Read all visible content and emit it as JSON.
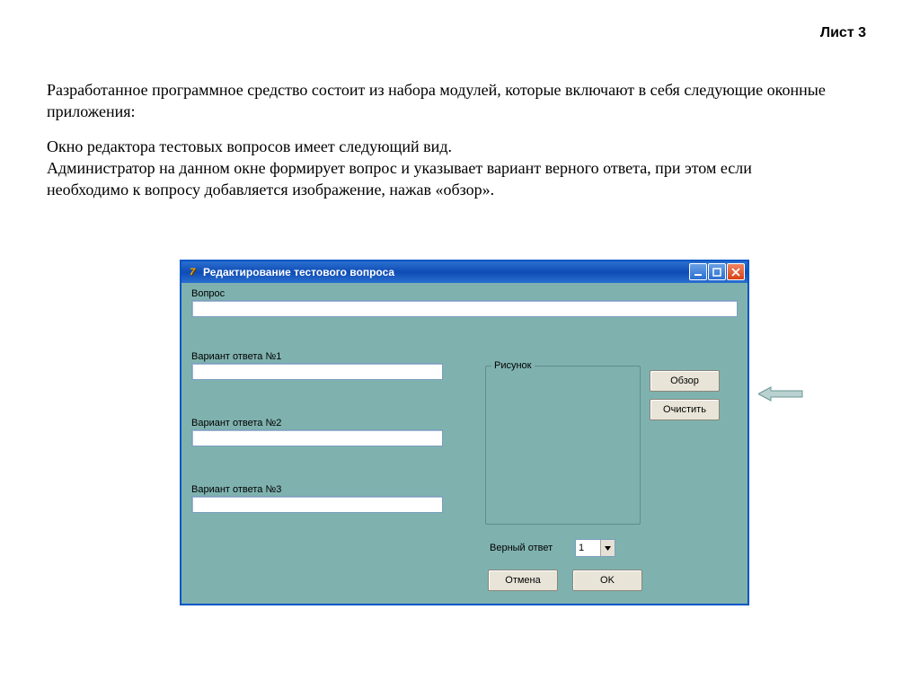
{
  "page_label": "Лист 3",
  "paragraph1": "Разработанное программное средство состоит из набора модулей, которые включают в себя следующие оконные приложения:",
  "paragraph2": "Окно редактора тестовых вопросов имеет следующий вид.",
  "paragraph3": "Администратор на данном окне формирует вопрос  и указывает вариант верного ответа, при этом если необходимо к вопросу добавляется изображение, нажав «обзор».",
  "window": {
    "title": "Редактирование тестового вопроса",
    "app_icon_glyph": "7",
    "labels": {
      "question": "Вопрос",
      "answer1": "Вариант ответа №1",
      "answer2": "Вариант ответа №2",
      "answer3": "Вариант ответа №3",
      "picture_group": "Рисунок",
      "correct_answer": "Верный ответ"
    },
    "fields": {
      "question": "",
      "answer1": "",
      "answer2": "",
      "answer3": "",
      "correct_answer_value": "1"
    },
    "buttons": {
      "browse": "Обзор",
      "clear": "Очистить",
      "cancel": "Отмена",
      "ok": "OK"
    }
  }
}
